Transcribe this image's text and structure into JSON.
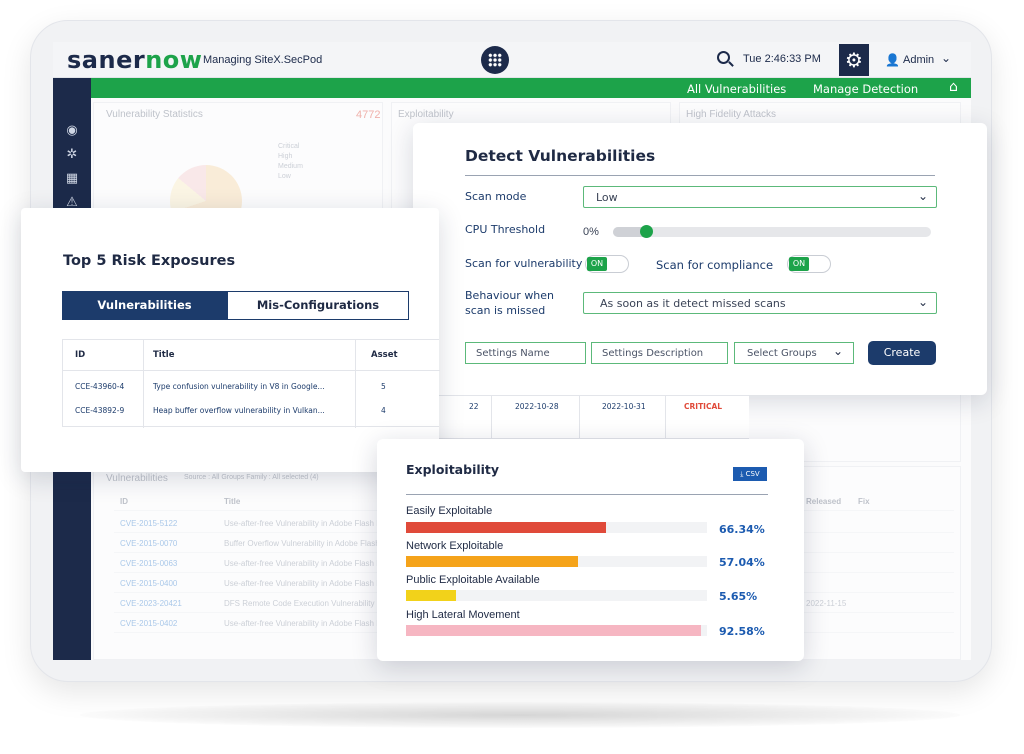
{
  "app": {
    "logo_part1": "saner",
    "logo_part2": "now",
    "managing": "Managing SiteX.SecPod",
    "time": "Tue 2:46:33 PM",
    "user": "Admin",
    "icons": {
      "grid": "grid-icon",
      "search": "search-icon",
      "gear": "gear-icon",
      "user": "user-icon",
      "chevron": "chevron-down-icon",
      "home": "home-icon"
    }
  },
  "nav": {
    "all_vulnerabilities": "All Vulnerabilities",
    "manage_detection": "Manage Detection"
  },
  "background": {
    "stats_title": "Vulnerability Statistics",
    "stats_count": "4772",
    "exploitability_title": "Exploitability",
    "hfa_title": "High Fidelity Attacks",
    "legend": [
      "Critical",
      "High",
      "Medium",
      "Low"
    ],
    "list_title": "Vulnerabilities",
    "list_filters": "Source : All Groups   Family : All selected (4)",
    "list_cols": [
      "ID",
      "Title",
      "Released",
      "Fix"
    ],
    "list_rows": [
      {
        "id": "CVE-2015-5122",
        "title": "Use-after-free Vulnerability in Adobe Flash Pla"
      },
      {
        "id": "CVE-2015-0070",
        "title": "Buffer Overflow Vulnerability in Adobe Flash P"
      },
      {
        "id": "CVE-2015-0063",
        "title": "Use-after-free Vulnerability in Adobe Flash Pla"
      },
      {
        "id": "CVE-2015-0400",
        "title": "Use-after-free Vulnerability in Adobe Flash Pla"
      },
      {
        "id": "CVE-2023-20421",
        "title": "DFS Remote Code Execution Vulnerability in Ti"
      },
      {
        "id": "CVE-2015-0402",
        "title": "Use-after-free Vulnerability in Adobe Flash Pla"
      }
    ],
    "released_date": "2022-11-15"
  },
  "detect": {
    "title": "Detect Vulnerabilities",
    "scan_mode_label": "Scan mode",
    "scan_mode_value": "Low",
    "cpu_label": "CPU Threshold",
    "cpu_value": "0%",
    "cpu_level": 0.12,
    "scan_vuln_label": "Scan for vulnerability",
    "scan_vuln_state": "ON",
    "scan_comp_label": "Scan for compliance",
    "scan_comp_state": "ON",
    "behaviour_label_1": "Behaviour when",
    "behaviour_label_2": "scan is missed",
    "behaviour_value": "As soon as it detect missed scans",
    "settings_name_placeholder": "Settings Name",
    "settings_desc_placeholder": "Settings Description",
    "groups_placeholder": "Select Groups",
    "create_label": "Create"
  },
  "top5": {
    "title": "Top 5 Risk Exposures",
    "tab_active": "Vulnerabilities",
    "tab_other": "Mis-Configurations",
    "columns": [
      "ID",
      "Title",
      "Asset"
    ],
    "rows": [
      {
        "id": "CCE-43960-4",
        "title": "Type confusion vulnerability in V8 in Google...",
        "asset": "5"
      },
      {
        "id": "CCE-43892-9",
        "title": "Heap buffer overflow vulnerability in Vulkan...",
        "asset": "4"
      }
    ],
    "row2_extra": {
      "count": "22",
      "date1": "2022-10-28",
      "date2": "2022-10-31",
      "severity": "CRITICAL"
    }
  },
  "exploitability": {
    "title": "Exploitability",
    "csv_label": "CSV",
    "bars": [
      {
        "label": "Easily Exploitable",
        "pct": "66.34%",
        "value": 0.6634,
        "color": "#e04a3a"
      },
      {
        "label": "Network Exploitable",
        "pct": "57.04%",
        "value": 0.5704,
        "color": "#f5a31a"
      },
      {
        "label": "Public Exploitable Available",
        "pct": "5.65%",
        "value": 0.1665,
        "color": "#f2d21a"
      },
      {
        "label": "High Lateral Movement",
        "pct": "92.58%",
        "value": 0.9785,
        "color": "#f6b6c2"
      }
    ]
  }
}
